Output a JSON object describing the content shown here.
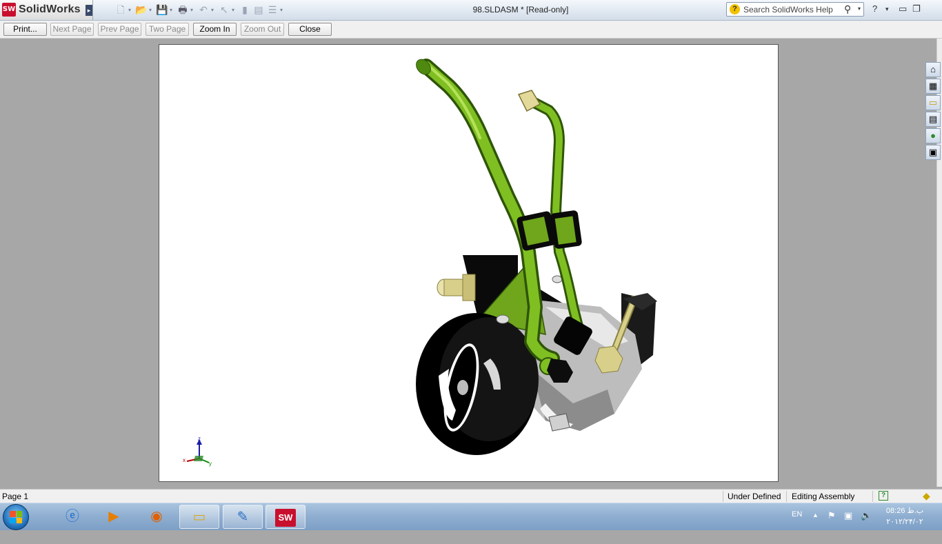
{
  "app": {
    "logo_badge": "SW",
    "logo_text": "SolidWorks",
    "document_title": "98.SLDASM * [Read-only]"
  },
  "quick_access": {
    "icons": [
      "new-icon",
      "open-icon",
      "save-icon",
      "print-icon",
      "undo-icon",
      "select-icon",
      "rebuild-icon",
      "file-properties-icon",
      "options-icon"
    ]
  },
  "search": {
    "placeholder": "Search SolidWorks Help",
    "help_badge": "?"
  },
  "window_controls": {
    "help": "?",
    "help_dropdown": "▾",
    "minimize": "▭",
    "restore": "❐"
  },
  "toolbar": {
    "print_label": "Print...",
    "next_page_label": "Next Page",
    "prev_page_label": "Prev Page",
    "two_page_label": "Two Page",
    "zoom_in_label": "Zoom In",
    "zoom_out_label": "Zoom Out",
    "close_label": "Close"
  },
  "triad": {
    "x": "x",
    "y": "y",
    "z": "z"
  },
  "task_pane": {
    "tabs": [
      "solidworks-resources-icon",
      "design-library-icon",
      "file-explorer-icon",
      "view-palette-icon",
      "appearances-icon",
      "custom-properties-icon"
    ]
  },
  "statusbar": {
    "page": "Page 1",
    "state": "Under Defined",
    "mode": "Editing Assembly",
    "help_badge": "?"
  },
  "taskbar": {
    "items": [
      "internet-explorer-icon",
      "media-player-icon",
      "firefox-icon",
      "file-explorer-icon",
      "paint-icon",
      "solidworks-icon"
    ],
    "solidworks_label": "SW",
    "language": "EN",
    "time": "08:26 ب.ظ",
    "date": "۲۰۱۲/۲۴/۰۲"
  },
  "colors": {
    "pipe_green": "#6fa61c",
    "pipe_green_dark": "#3d6b0a",
    "brass": "#d8cf8a",
    "pulley_black": "#050505",
    "housing_gray": "#b8b8b8",
    "sw_red": "#c8102e"
  }
}
